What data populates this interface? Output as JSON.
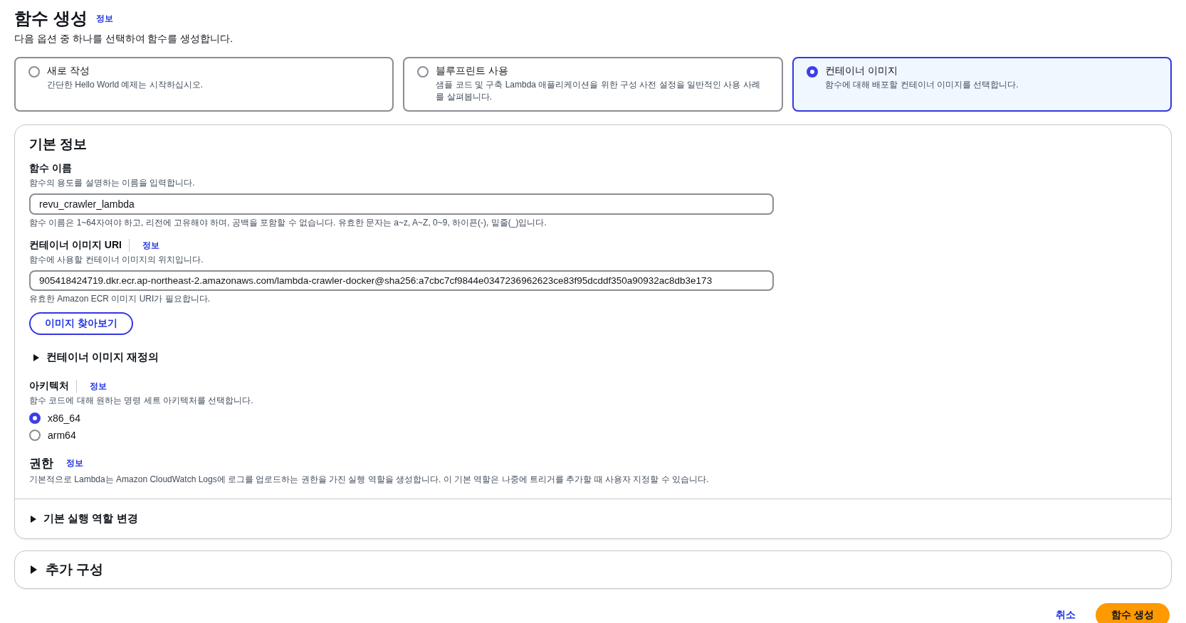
{
  "header": {
    "title": "함수 생성",
    "info_link": "정보",
    "description": "다음 옵션 중 하나를 선택하여 함수를 생성합니다."
  },
  "options": [
    {
      "title": "새로 작성",
      "description": "간단한 Hello World 예제는 시작하십시오.",
      "selected": false
    },
    {
      "title": "블루프린트 사용",
      "description": "샘플 코드 및 구축 Lambda 애플리케이션을 위한 구성 사전 설정을 일반적인 사용 사례를 살펴봅니다.",
      "selected": false
    },
    {
      "title": "컨테이너 이미지",
      "description": "함수에 대해 배포할 컨테이너 이미지를 선택합니다.",
      "selected": true
    }
  ],
  "basic_info": {
    "title": "기본 정보",
    "function_name": {
      "label": "함수 이름",
      "description": "함수의 용도를 설명하는 이름을 입력합니다.",
      "value": "revu_crawler_lambda",
      "constraint": "함수 이름은 1~64자여야 하고, 리전에 고유해야 하며, 공백을 포함할 수 없습니다. 유효한 문자는 a~z, A~Z, 0~9, 하이픈(-), 밑줄(_)입니다."
    },
    "image_uri": {
      "label": "컨테이너 이미지 URI",
      "info_link": "정보",
      "description": "함수에 사용할 컨테이너 이미지의 위치입니다.",
      "value": "905418424719.dkr.ecr.ap-northeast-2.amazonaws.com/lambda-crawler-docker@sha256:a7cbc7cf9844e0347236962623ce83f95dcddf350a90932ac8db3e173",
      "hint": "유효한 Amazon ECR 이미지 URI가 필요합니다.",
      "browse_button": "이미지 찾아보기"
    },
    "override": {
      "label": "컨테이너 이미지 재정의",
      "expanded": false
    },
    "architecture": {
      "label": "아키텍처",
      "info_link": "정보",
      "description": "함수 코드에 대해 원하는 명령 세트 아키텍처를 선택합니다.",
      "options": [
        {
          "label": "x86_64",
          "selected": true
        },
        {
          "label": "arm64",
          "selected": false
        }
      ]
    },
    "permissions": {
      "title": "권한",
      "info_link": "정보",
      "description": "기본적으로 Lambda는 Amazon CloudWatch Logs에 로그를 업로드하는 권한을 가진 실행 역할을 생성합니다. 이 기본 역할은 나중에 트리거를 추가할 때 사용자 지정할 수 있습니다."
    },
    "role_change": {
      "label": "기본 실행 역할 변경",
      "expanded": false
    }
  },
  "advanced": {
    "label": "추가 구성",
    "expanded": false
  },
  "footer": {
    "cancel": "취소",
    "submit": "함수 생성"
  }
}
